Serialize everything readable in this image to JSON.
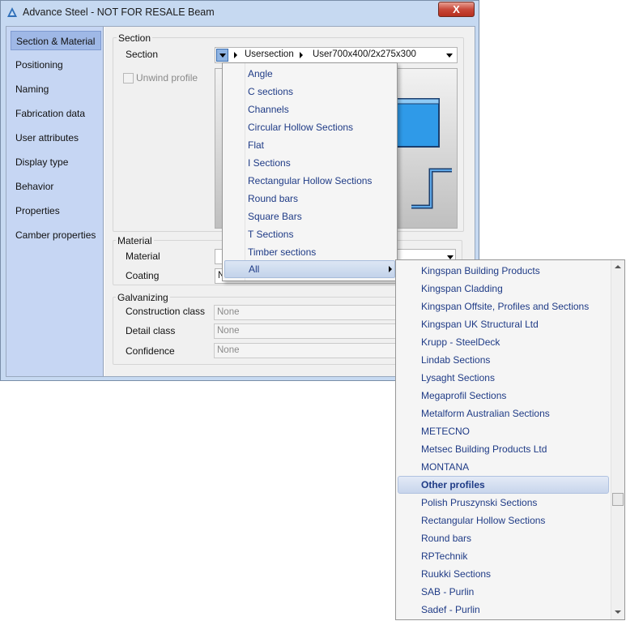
{
  "window": {
    "title": "Advance Steel - NOT FOR RESALE   Beam",
    "close_label": "X"
  },
  "nav": [
    "Section & Material",
    "Positioning",
    "Naming",
    "Fabrication data",
    "User attributes",
    "Display type",
    "Behavior",
    "Properties",
    "Camber properties"
  ],
  "section": {
    "group_label": "Section",
    "row_label": "Section",
    "path_1": "Usersection",
    "path_2": "User700x400/2x275x300",
    "unwind_label": "Unwind profile"
  },
  "material": {
    "group_label": "Material",
    "material_label": "Material",
    "coating_label": "Coating",
    "coating_value": "N"
  },
  "galvanizing": {
    "group_label": "Galvanizing",
    "rows": [
      {
        "label": "Construction class",
        "value": "None"
      },
      {
        "label": "Detail class",
        "value": "None"
      },
      {
        "label": "Confidence",
        "value": "None"
      }
    ]
  },
  "menu1": {
    "items": [
      "Angle",
      "C sections",
      "Channels",
      "Circular Hollow Sections",
      "Flat",
      "I Sections",
      "Rectangular Hollow Sections",
      "Round bars",
      "Square Bars",
      "T Sections",
      "Timber sections"
    ],
    "all_label": "All"
  },
  "menu2": {
    "items": [
      "Kingspan Building Products",
      "Kingspan Cladding",
      "Kingspan Offsite, Profiles and Sections",
      "Kingspan UK Structural Ltd",
      "Krupp - SteelDeck",
      "Lindab Sections",
      "Lysaght Sections",
      "Megaprofil  Sections",
      "Metalform Australian Sections",
      "METECNO",
      "Metsec Building Products Ltd",
      "MONTANA",
      "Other profiles",
      "Polish Pruszynski Sections",
      "Rectangular Hollow Sections",
      "Round bars",
      "RPTechnik",
      "Ruukki Sections",
      "SAB - Purlin",
      "Sadef - Purlin"
    ],
    "highlighted": "Other profiles"
  }
}
